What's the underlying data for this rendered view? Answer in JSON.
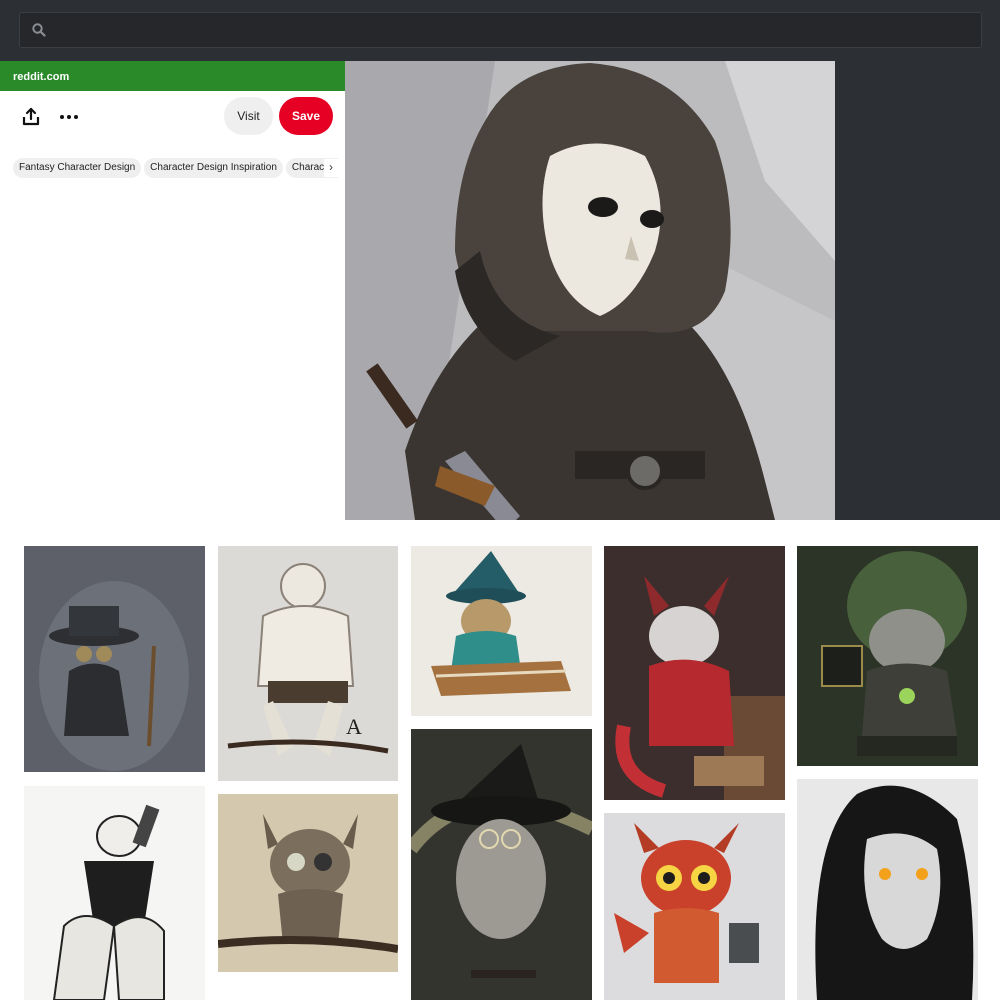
{
  "search": {
    "placeholder": "",
    "value": ""
  },
  "pin": {
    "source": "reddit.com",
    "visit_label": "Visit",
    "save_label": "Save",
    "tags": [
      "Fantasy Character Design",
      "Character Design Inspiration",
      "Character Design"
    ]
  },
  "colors": {
    "source_bar": "#2a8a2a",
    "save_button": "#e60023",
    "top_background": "#2c2f33"
  },
  "icons": [
    "search-icon",
    "share-icon",
    "more-icon",
    "chevron-right-icon"
  ]
}
